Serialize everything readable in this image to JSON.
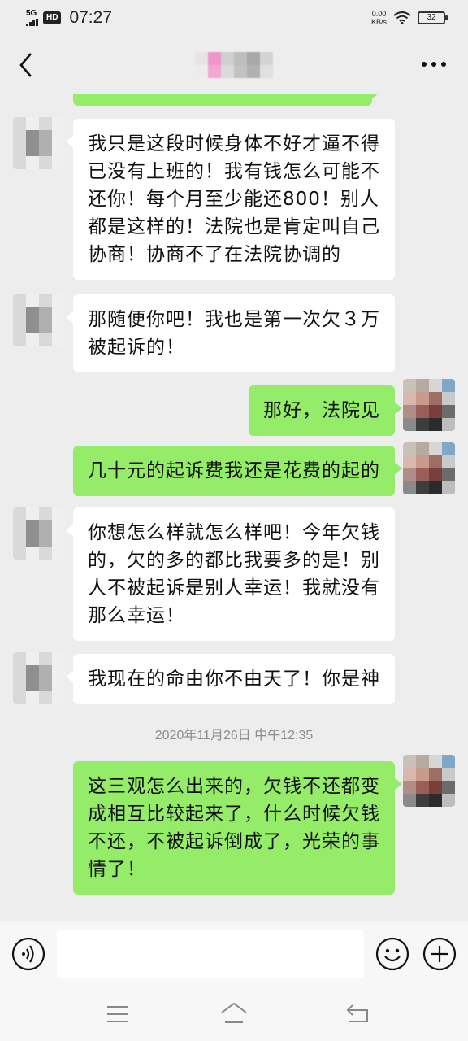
{
  "status_bar": {
    "network": "5G",
    "hd": "HD",
    "time": "07:27",
    "net_speed_value": "0.00",
    "net_speed_unit": "KB/s",
    "battery": "32"
  },
  "header": {
    "back_icon": "chevron-left-icon",
    "more_icon": "more-horizontal-icon"
  },
  "messages": [
    {
      "side": "in",
      "text": "我只是这段时候身体不好才逼不得已没有上班的！我有钱怎么可能不还你！每个月至少能还800！别人都是这样的！法院也是肯定叫自己协商！协商不了在法院协调的"
    },
    {
      "side": "in",
      "text": "那随便你吧！我也是第一次欠３万被起诉的！"
    },
    {
      "side": "out",
      "text": "那好，法院见"
    },
    {
      "side": "out",
      "text": "几十元的起诉费我还是花费的起的"
    },
    {
      "side": "in",
      "text": "你想怎么样就怎么样吧！今年欠钱的，欠的多的都比我要多的是！别人不被起诉是别人幸运！我就没有那么幸运！"
    },
    {
      "side": "in",
      "text": "我现在的命由你不由天了！你是神"
    },
    {
      "side": "out",
      "text": "这三观怎么出来的，欠钱不还都变成相互比较起来了，什么时候欠钱不还，不被起诉倒成了，光荣的事情了！"
    }
  ],
  "timestamp": "2020年11月26日 中午12:35",
  "input_bar": {
    "voice_icon": "voice-icon",
    "input_value": "",
    "emoji_icon": "emoji-icon",
    "plus_icon": "plus-circle-icon"
  },
  "nav_bar": {
    "menu_icon": "menu-icon",
    "home_icon": "home-icon",
    "back_icon": "back-icon"
  },
  "colors": {
    "background": "#ededed",
    "bubble_in": "#ffffff",
    "bubble_out": "#95ec69",
    "timestamp": "#8c8c8c"
  }
}
